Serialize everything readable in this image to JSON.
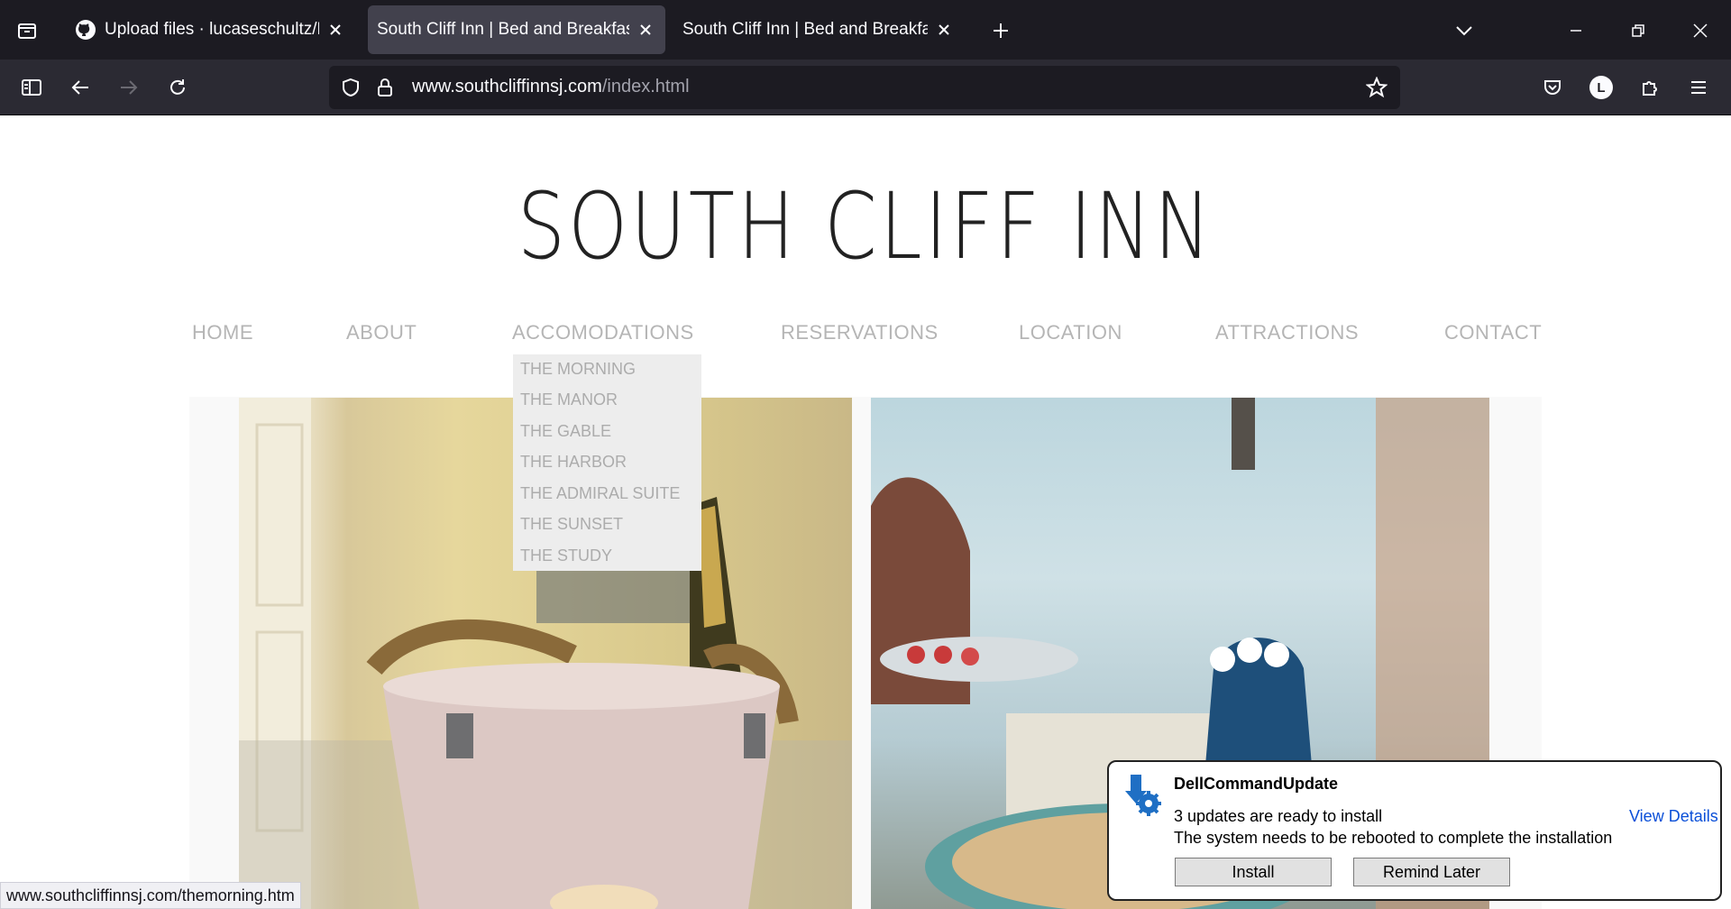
{
  "browser": {
    "tabs": [
      {
        "title": "Upload files · lucaseschultz/HTML",
        "active": false
      },
      {
        "title": "South Cliff Inn | Bed and Breakfast |",
        "active": true
      },
      {
        "title": "South Cliff Inn | Bed and Breakfast |",
        "active": false
      }
    ],
    "url_domain": "www.southcliffinnsj.com",
    "url_path": "/index.html",
    "profile_initial": "L",
    "status_link": "www.southcliffinnsj.com/themorning.htm"
  },
  "site": {
    "title": "SOUTH CLIFF INN",
    "menu": [
      "HOME",
      "ABOUT",
      "ACCOMODATIONS",
      "RESERVATIONS",
      "LOCATION",
      "ATTRACTIONS",
      "CONTACT"
    ],
    "dropdown": [
      "THE MORNING",
      "THE MANOR",
      "THE GABLE",
      "THE HARBOR",
      "THE ADMIRAL SUITE",
      "THE SUNSET",
      "THE STUDY"
    ]
  },
  "toast": {
    "app_name": "DellCommandUpdate",
    "line1": "3 updates are ready to install",
    "line2": "The system needs to be rebooted to complete the installation",
    "link": "View Details",
    "install_label": "Install",
    "remind_label": "Remind Later"
  },
  "colors": {
    "tabbar_bg": "#1c1b22",
    "navbar_bg": "#2b2a33",
    "menu_text": "#b5b5b5",
    "toast_link": "#0a4fd8"
  }
}
